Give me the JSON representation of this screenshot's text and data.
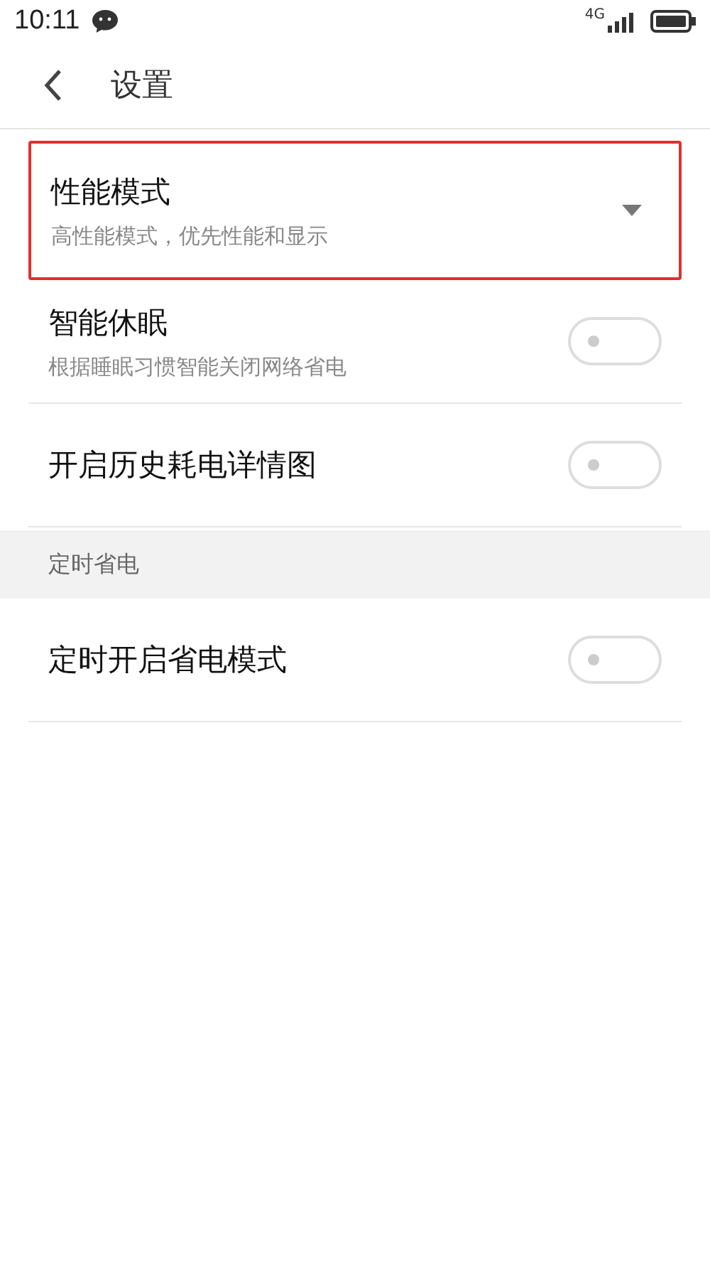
{
  "status_bar": {
    "time": "10:11",
    "network": "4G"
  },
  "header": {
    "title": "设置"
  },
  "sections": [
    {
      "items": [
        {
          "kind": "dropdown",
          "title": "性能模式",
          "subtitle": "高性能模式，优先性能和显示",
          "highlighted": true
        },
        {
          "kind": "toggle",
          "title": "智能休眠",
          "subtitle": "根据睡眠习惯智能关闭网络省电",
          "on": false,
          "highlighted": false
        },
        {
          "kind": "toggle",
          "title": "开启历史耗电详情图",
          "on": false,
          "highlighted": false
        }
      ]
    },
    {
      "heading": "定时省电",
      "items": [
        {
          "kind": "toggle",
          "title": "定时开启省电模式",
          "on": false,
          "highlighted": false
        }
      ]
    }
  ]
}
